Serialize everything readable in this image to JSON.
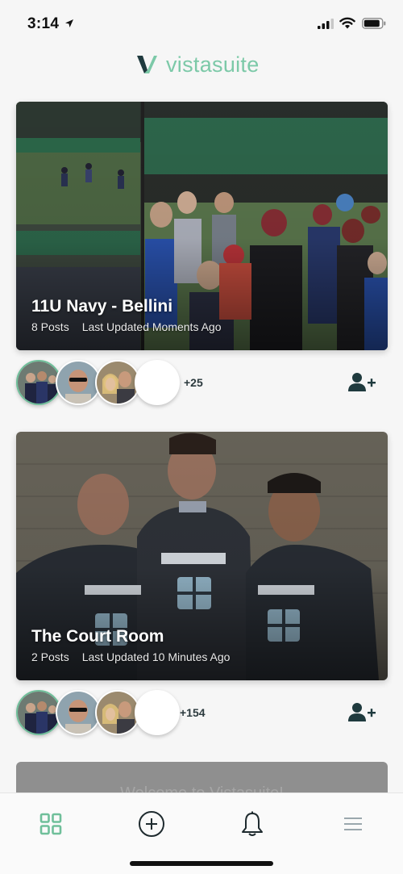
{
  "status_bar": {
    "time": "3:14",
    "icons": [
      "location-arrow-icon",
      "cellular-signal-icon",
      "wifi-icon",
      "battery-icon"
    ]
  },
  "header": {
    "logo_text": "vistasuite",
    "brand_color": "#7cc9a8"
  },
  "groups": [
    {
      "title": "11U Navy - Bellini",
      "posts": "8 Posts",
      "updated": "Last Updated Moments Ago",
      "more_members": "+25"
    },
    {
      "title": "The Court Room",
      "posts": "2 Posts",
      "updated": "Last Updated 10 Minutes Ago",
      "more_members": "+154"
    }
  ],
  "partial_card": {
    "text": "Welcome to Vistasuite!"
  },
  "tab_bar": {
    "tabs": [
      "grid-icon",
      "add-circle-icon",
      "bell-icon",
      "menu-icon"
    ],
    "active_color": "#6fbf9a"
  }
}
